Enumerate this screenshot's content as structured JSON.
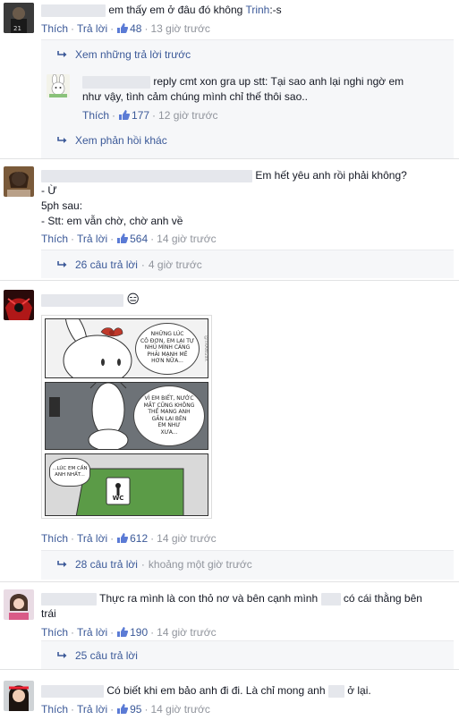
{
  "common": {
    "like_label": "Thích",
    "reply_label": "Trả lời",
    "separator": "·"
  },
  "comments": [
    {
      "text": "em thấy em ở đâu đó không",
      "tag": "Trinh",
      "suffix": ":-s",
      "likes": "48",
      "time": "13 giờ trước",
      "view_prev": "Xem những trả lời trước",
      "reply": {
        "text_line1": "reply cmt xon gra up stt: Tại sao anh lại nghi ngờ em",
        "text_line2": "như vậy, tình cảm chúng mình chỉ thế thôi sao..",
        "likes": "177",
        "time": "12 giờ trước"
      },
      "view_more": "Xem phản hồi khác"
    },
    {
      "line1": "Em hết yêu anh rồi phải không?",
      "line2": "- Ừ",
      "line3": "5ph sau:",
      "line4": "- Stt: em vẫn chờ, chờ anh về",
      "likes": "564",
      "time": "14 giờ trước",
      "replies_count": "26 câu trả lời",
      "replies_time": "4 giờ trước"
    },
    {
      "emoji": "😑",
      "comic": {
        "panel1": [
          "NHỮNG LÚC",
          "CÔ ĐƠN, EM LẠI TỰ",
          "NHỦ MÌNH CÀNG",
          "PHẢI MẠNH MẼ",
          "HƠN NỮA..."
        ],
        "panel2": [
          "VÌ EM BIẾT, NƯỚC",
          "MẮT CŨNG KHÔNG",
          "THỂ MANG ANH",
          "GẦN LẠI BÊN",
          "EM NHƯ",
          "XƯA..."
        ],
        "panel3": [
          "...LÚC EM CẦN",
          "ANH NHẤT..."
        ],
        "wc": "WC",
        "watermark": "@TRANG9X"
      },
      "likes": "612",
      "time": "14 giờ trước",
      "replies_count": "28 câu trả lời",
      "replies_time": "khoảng một giờ trước"
    },
    {
      "line1": "Thực ra mình là con thỏ nơ và bên cạnh mình",
      "line1b": "có cái thằng bên",
      "line2": "trái",
      "likes": "190",
      "time": "14 giờ trước",
      "replies_count": "25 câu trả lời"
    },
    {
      "line1a": "Có biết khi em bảo anh đi đi. Là chỉ mong anh",
      "line1b": "ở lại.",
      "likes": "95",
      "time": "14 giờ trước"
    }
  ],
  "colors": {
    "link": "#3b5998",
    "meta": "#90949c",
    "text": "#141823",
    "reply_bg": "#f6f7f9"
  }
}
